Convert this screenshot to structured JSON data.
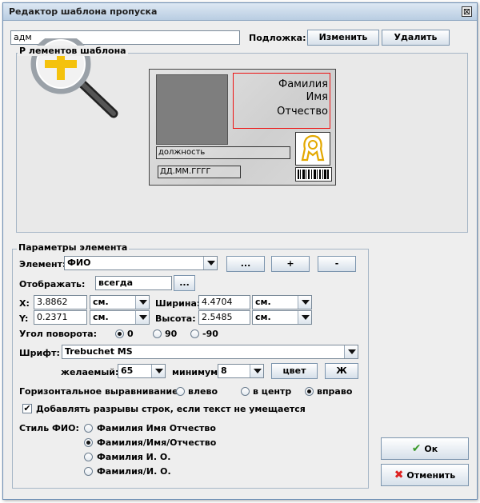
{
  "window": {
    "title": "Редактор шаблона пропуска",
    "close_glyph": "⊠"
  },
  "template": {
    "name_value": "адм",
    "background_label": "Подложка:",
    "change_button": "Изменить",
    "delete_button": "Удалить",
    "layout_group_title": "Р          лементов шаблона"
  },
  "card": {
    "fio_lines": [
      "Фамилия",
      "Имя",
      "Отчество"
    ],
    "position_placeholder": "должность",
    "date_placeholder": "ДД.ММ.ГГГГ"
  },
  "params": {
    "group_title": "Параметры элемента",
    "element_label": "Элемент:",
    "element_value": "ФИО",
    "btn_dots": "...",
    "btn_add": "+",
    "btn_remove": "-",
    "display_label": "Отображать:",
    "display_value": "всегда",
    "display_btn": "...",
    "x_label": "X:",
    "x_value": "3.8862",
    "x_unit": "см.",
    "y_label": "Y:",
    "y_value": "0.2371",
    "y_unit": "см.",
    "width_label": "Ширина:",
    "width_value": "4.4704",
    "width_unit": "см.",
    "height_label": "Высота:",
    "height_value": "2.5485",
    "height_unit": "см.",
    "rotation_label": "Угол поворота:",
    "rotation_options": [
      "0",
      "90",
      "-90"
    ],
    "rotation_selected": "0",
    "font_label": "Шрифт:",
    "font_value": "Trebuchet MS",
    "desired_label": "желаемый:",
    "desired_value": "65",
    "min_label": "минимум:",
    "min_value": "8",
    "color_btn": "цвет",
    "bold_btn": "Ж",
    "halign_label": "Горизонтальное выравнивание:",
    "halign_options": [
      "влево",
      "в центр",
      "вправо"
    ],
    "halign_selected": "вправо",
    "wrap_label": "Добавлять разрывы строк, если текст не умещается",
    "wrap_checked": true,
    "fio_style_label": "Стиль ФИО:",
    "fio_style_options": [
      "Фамилия Имя Отчество",
      "Фамилия/Имя/Отчество",
      "Фамилия И. О.",
      "Фамилия/И. О."
    ],
    "fio_style_selected": "Фамилия/Имя/Отчество"
  },
  "footer": {
    "ok_button": "Ок",
    "cancel_button": "Отменить"
  },
  "colors": {
    "accent_red": "#e11111",
    "ok_green": "#3a9a2a",
    "cancel_red": "#d22",
    "magnifier_plus": "#f4c20d"
  },
  "icons": [
    "close-icon",
    "magnifier-add-icon",
    "emblem-icon",
    "barcode-icon",
    "ok-check-icon",
    "cancel-x-icon"
  ]
}
